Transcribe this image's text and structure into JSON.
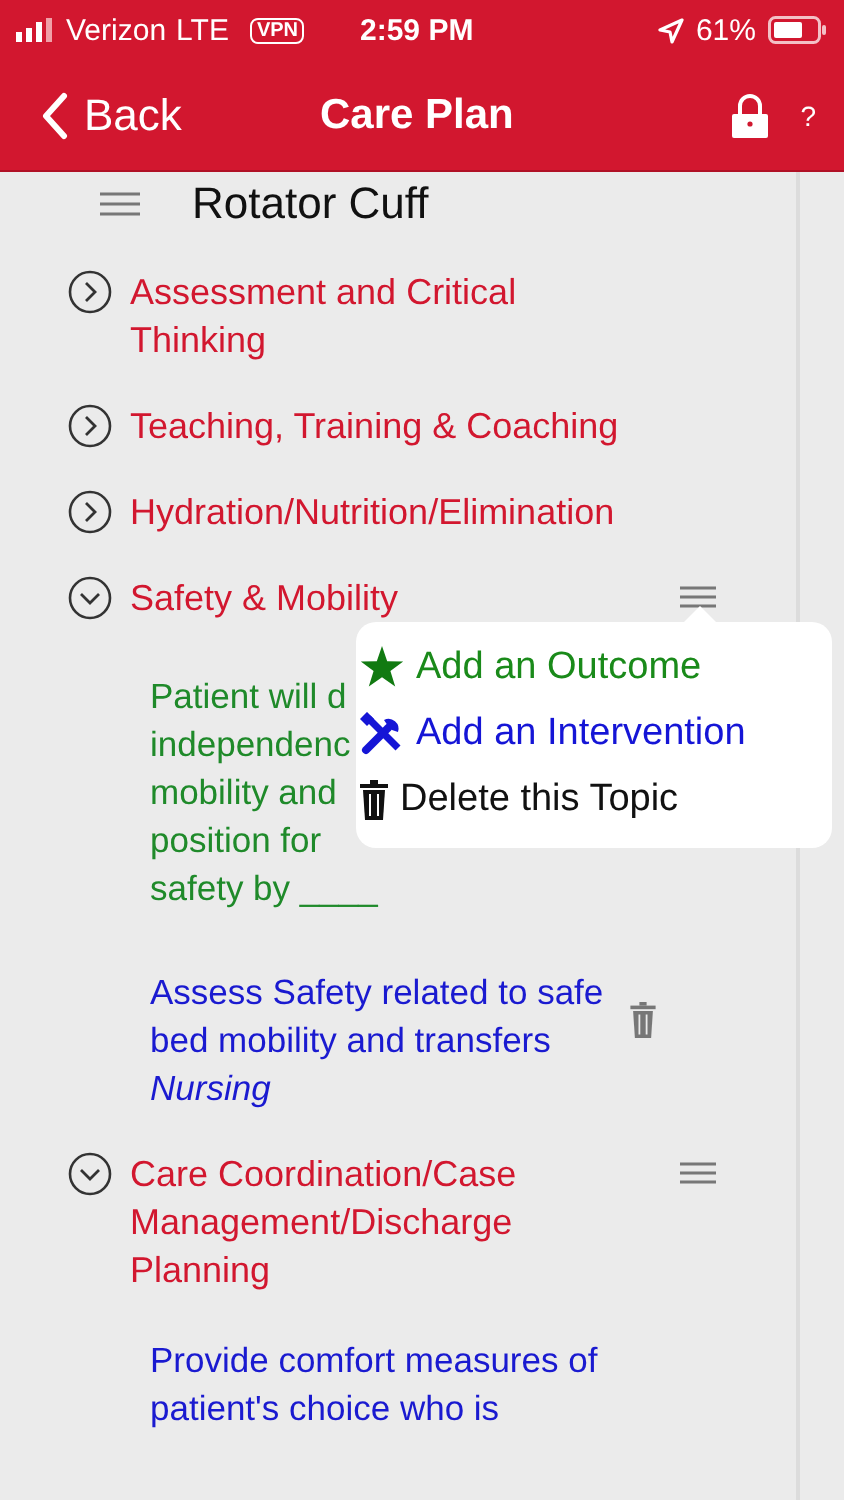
{
  "status_bar": {
    "carrier": "Verizon",
    "network": "LTE",
    "vpn": "VPN",
    "time": "2:59 PM",
    "battery": "61%"
  },
  "nav": {
    "back": "Back",
    "title": "Care Plan",
    "help": "?"
  },
  "plan": {
    "title": "Rotator Cuff"
  },
  "topics": [
    {
      "title": "Assessment and Critical Thinking",
      "expanded": false
    },
    {
      "title": "Teaching, Training & Coaching",
      "expanded": false
    },
    {
      "title": "Hydration/Nutrition/Elimination",
      "expanded": false
    },
    {
      "title": "Safety & Mobility",
      "expanded": true,
      "menu_open": true,
      "children": [
        {
          "kind": "outcome",
          "lines": [
            "Patient will d",
            "independenc",
            "mobility and",
            "position for",
            "safety by ____"
          ]
        },
        {
          "kind": "intervention",
          "text": "Assess Safety related to safe bed mobility and transfers",
          "discipline": "Nursing"
        }
      ]
    },
    {
      "title": "Care Coordination/Case Management/Discharge Planning",
      "expanded": true,
      "children": [
        {
          "kind": "intervention",
          "text": "Provide comfort measures of patient's choice who is"
        }
      ]
    }
  ],
  "menu": [
    {
      "kind": "outcome",
      "label": "Add an Outcome"
    },
    {
      "kind": "intervention",
      "label": "Add an Intervention"
    },
    {
      "kind": "delete",
      "label": "Delete this Topic"
    }
  ]
}
